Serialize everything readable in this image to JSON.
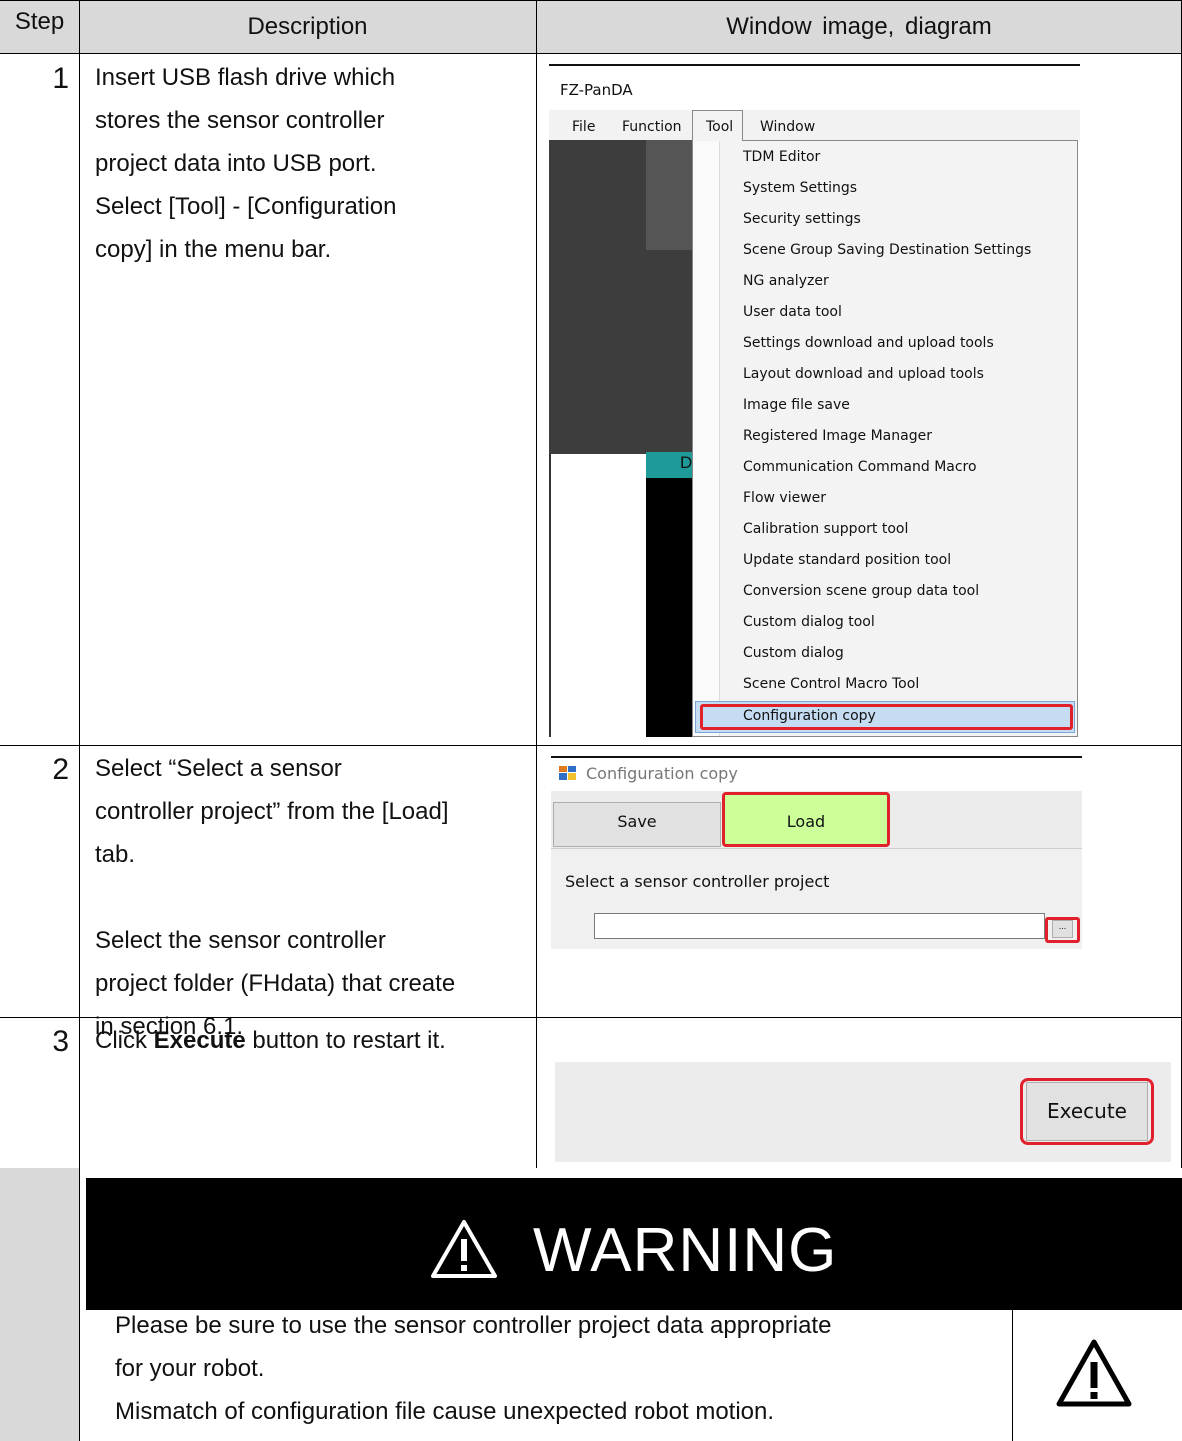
{
  "table": {
    "headers": [
      "Step",
      "Description",
      "Window image, diagram"
    ],
    "rows": [
      {
        "step": "1",
        "description_lines": [
          "Insert USB flash drive which",
          "stores the sensor controller",
          "project data into USB port.",
          "Select [Tool] - [Configuration",
          "copy] in the menu bar."
        ]
      },
      {
        "step": "2",
        "description_lines": [
          "Select “Select a sensor",
          "controller project” from the [Load]",
          "tab.",
          "",
          "Select the sensor controller",
          "project folder (FHdata) that create",
          "in section 6.1."
        ]
      },
      {
        "step": "3",
        "description_prefix": "Click ",
        "description_bold": "Execute",
        "description_suffix": " button to restart it."
      }
    ]
  },
  "screenshot1": {
    "app_title": "FZ-PanDA",
    "menubar": [
      "File",
      "Function",
      "Tool",
      "Window"
    ],
    "partial_label": "D",
    "menu_items": [
      "TDM Editor",
      "System Settings",
      "Security settings",
      "Scene Group Saving Destination Settings",
      "NG analyzer",
      "User data tool",
      "Settings download and upload tools",
      "Layout download and upload tools",
      "Image file save",
      "Registered Image Manager",
      "Communication Command Macro",
      "Flow viewer",
      "Calibration support tool",
      "Update standard position tool",
      "Conversion scene group data tool",
      "Custom dialog tool",
      "Custom dialog",
      "Scene Control Macro Tool",
      "Configuration copy"
    ]
  },
  "screenshot2": {
    "window_title": "Configuration copy",
    "tabs": [
      "Save",
      "Load"
    ],
    "field_label": "Select a sensor controller project",
    "field_value": "",
    "browse_label": "..."
  },
  "screenshot3": {
    "execute_label": "Execute"
  },
  "warning": {
    "title": "WARNING",
    "lines": [
      "Please be sure to use the sensor controller project data appropriate",
      "for your robot.",
      "Mismatch of configuration file cause unexpected robot motion."
    ]
  },
  "colors": {
    "highlight_red": "#e0202a",
    "load_tab_green": "#ccff99",
    "menu_selection_blue": "#c5dcf2",
    "teal": "#1e9a98"
  }
}
